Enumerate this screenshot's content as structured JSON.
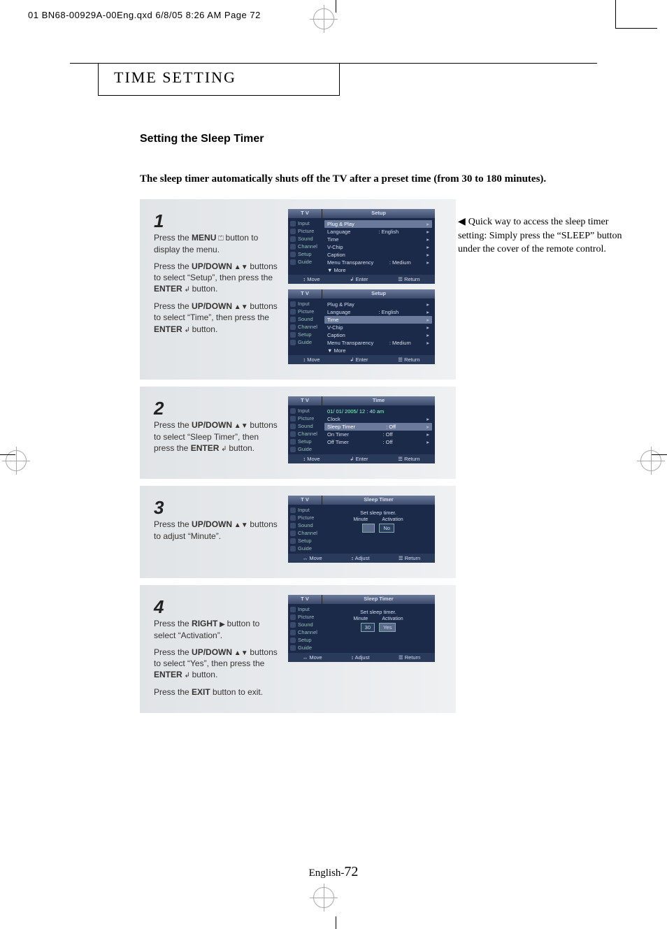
{
  "print_header": "01 BN68-00929A-00Eng.qxd  6/8/05 8:26 AM  Page 72",
  "section_title": "TIME SETTING",
  "subhead": "Setting the Sleep Timer",
  "intro": "The sleep timer automatically shuts off the TV after a preset time (from 30 to 180 minutes).",
  "sidenote": "Quick way to access the sleep timer setting: Simply press the “SLEEP” button under the cover of the remote control.",
  "footer_label": "English-",
  "footer_page": "72",
  "steps": {
    "s1": {
      "num": "1",
      "p1a": "Press the ",
      "p1b": "MENU",
      "p1c": " button to display the menu.",
      "p2a": "Press the ",
      "p2b": "UP/DOWN",
      "p2c": " buttons to select “Setup”, then press the ",
      "p2d": "ENTER",
      "p2e": " button.",
      "p3a": "Press the ",
      "p3b": "UP/DOWN",
      "p3c": " buttons to select “Time”, then press the ",
      "p3d": "ENTER",
      "p3e": " button."
    },
    "s2": {
      "num": "2",
      "p1a": "Press the ",
      "p1b": "UP/DOWN",
      "p1c": " buttons to select “Sleep Timer”, then press the ",
      "p1d": "ENTER",
      "p1e": " button."
    },
    "s3": {
      "num": "3",
      "p1a": "Press the ",
      "p1b": "UP/DOWN",
      "p1c": " buttons to adjust “Minute”."
    },
    "s4": {
      "num": "4",
      "p1a": "Press the ",
      "p1b": "RIGHT",
      "p1c": " button to select “Activation”.",
      "p2a": "Press the ",
      "p2b": "UP/DOWN",
      "p2c": " buttons to select “Yes”, then press the ",
      "p2d": "ENTER",
      "p2e": " button.",
      "p3a": "Press the ",
      "p3b": "EXIT",
      "p3c": " button to exit."
    }
  },
  "osd": {
    "tv": "T V",
    "side": [
      "Input",
      "Picture",
      "Sound",
      "Channel",
      "Setup",
      "Guide"
    ],
    "setup_title": "Setup",
    "time_title": "Time",
    "sleep_title": "Sleep Timer",
    "setup_items": {
      "plug": "Plug & Play",
      "lang": "Language",
      "lang_val": ": English",
      "time": "Time",
      "vchip": "V-Chip",
      "caption": "Caption",
      "trans": "Menu Transparency",
      "trans_val": ": Medium",
      "more": "▼ More"
    },
    "time_items": {
      "datetime": "01/ 01/ 2005/ 12 : 40 am",
      "clock": "Clock",
      "sleep": "Sleep Timer",
      "on": "On Timer",
      "off": "Off Timer",
      "val_off": ": Off"
    },
    "sleep_items": {
      "msg": "Set sleep timer.",
      "min_label": "Minute",
      "act_label": "Activation",
      "min30": "30",
      "min_blank": "   ",
      "no": "No",
      "yes": "Yes"
    },
    "foot": {
      "move": "↕ Move",
      "lrmove": "↔ Move",
      "enter": "↲ Enter",
      "adjust": "↕ Adjust",
      "ret": "☰ Return"
    }
  }
}
